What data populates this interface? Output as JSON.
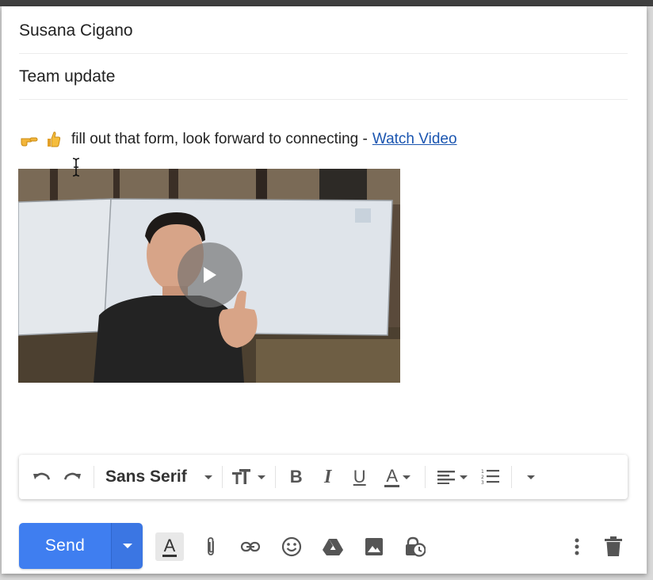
{
  "compose": {
    "to": "Susana Cigano",
    "subject": "Team update",
    "body_text": "fill out that form, look forward to connecting -",
    "link_text": "Watch Video"
  },
  "video": {
    "play_icon": "play-icon"
  },
  "toolbar": {
    "font": "Sans Serif",
    "bold": "B",
    "italic": "I",
    "underline": "U",
    "text_color": "A"
  },
  "actions": {
    "send_label": "Send",
    "format_label": "A"
  },
  "colors": {
    "send_blue": "#3f7ef0",
    "link_blue": "#1a55b0",
    "icon_gray": "#555555"
  }
}
